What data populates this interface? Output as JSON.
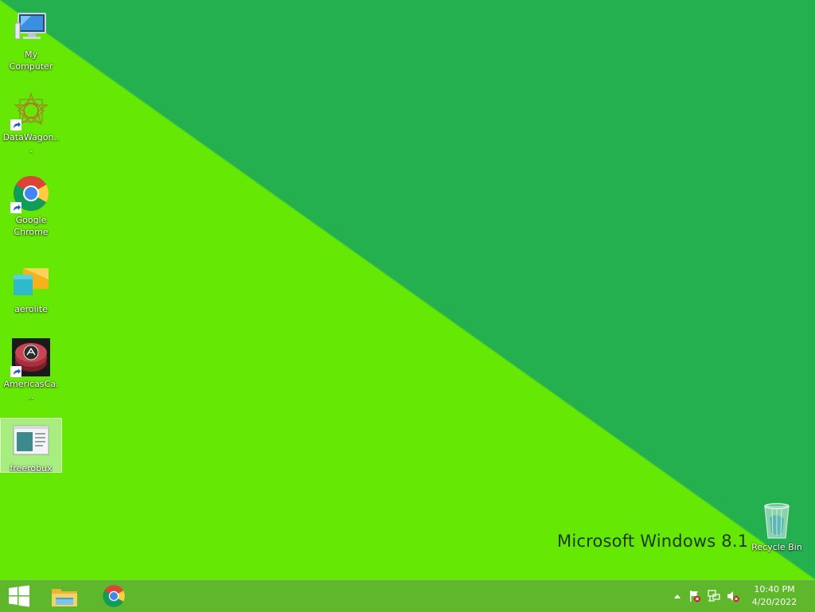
{
  "desktop": {
    "icons": [
      {
        "label": "My Computer",
        "icon": "computer-icon"
      },
      {
        "label": "DataWagon...",
        "icon": "datawagon-icon"
      },
      {
        "label": "Google Chrome",
        "icon": "chrome-icon"
      },
      {
        "label": "aerolite",
        "icon": "aerolite-icon"
      },
      {
        "label": "AmericasCa...",
        "icon": "americascasino-icon"
      },
      {
        "label": "freerobux",
        "icon": "document-icon"
      }
    ],
    "recycle_bin": {
      "label": "Recycle Bin",
      "icon": "recycle-bin-icon"
    },
    "brand_text": "Microsoft Windows 8.1",
    "colors": {
      "light": "#66e805",
      "dark": "#25b04f",
      "taskbar": "#5fb72b"
    }
  },
  "taskbar": {
    "start": "windows-logo-icon",
    "pinned": [
      "file-explorer-icon",
      "chrome-icon"
    ],
    "tray": [
      "show-hidden-icons-arrow",
      "action-center-flag-icon",
      "network-icon",
      "volume-muted-icon"
    ],
    "clock": {
      "time": "10:40 PM",
      "date": "4/20/2022"
    }
  }
}
